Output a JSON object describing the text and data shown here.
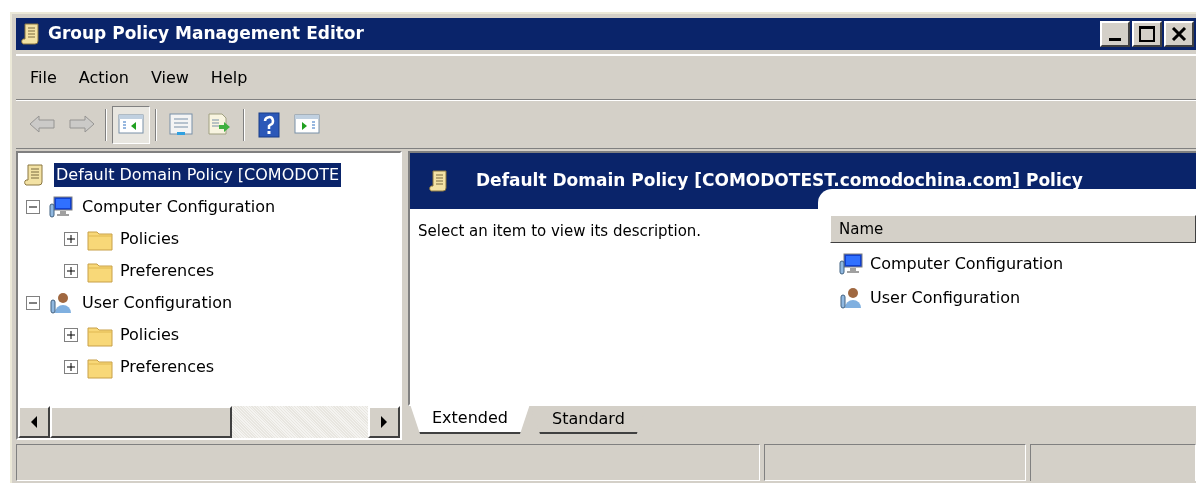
{
  "window": {
    "title": "Group Policy Management Editor"
  },
  "menu": [
    "File",
    "Action",
    "View",
    "Help"
  ],
  "toolbar": [
    {
      "disabled": true,
      "pressed": false
    },
    {
      "disabled": true,
      "pressed": false
    },
    {
      "disabled": false,
      "pressed": true
    },
    {
      "disabled": false,
      "pressed": false
    },
    {
      "disabled": false,
      "pressed": false
    },
    {
      "disabled": false,
      "pressed": false
    },
    {
      "disabled": false,
      "pressed": false
    }
  ],
  "tree": {
    "label": "Default Domain Policy [COMODOTE",
    "selected": true,
    "children": [
      {
        "label": "Computer Configuration",
        "expanded": true,
        "selected": false,
        "children": [
          {
            "label": "Policies",
            "expanded": false,
            "selected": false
          },
          {
            "label": "Preferences",
            "expanded": false,
            "selected": false
          }
        ]
      },
      {
        "label": "User Configuration",
        "expanded": true,
        "selected": false,
        "children": [
          {
            "label": "Policies",
            "expanded": false,
            "selected": false
          },
          {
            "label": "Preferences",
            "expanded": false,
            "selected": false
          }
        ]
      }
    ]
  },
  "details": {
    "title": "Default Domain Policy [COMODOTEST.comodochina.com] Policy",
    "description": "Select an item to view its description.",
    "columns": [
      "Name"
    ],
    "rows": [
      "Computer Configuration",
      "User Configuration"
    ]
  },
  "tabs": [
    {
      "label": "Extended",
      "selected": true
    },
    {
      "label": "Standard",
      "selected": false
    }
  ]
}
